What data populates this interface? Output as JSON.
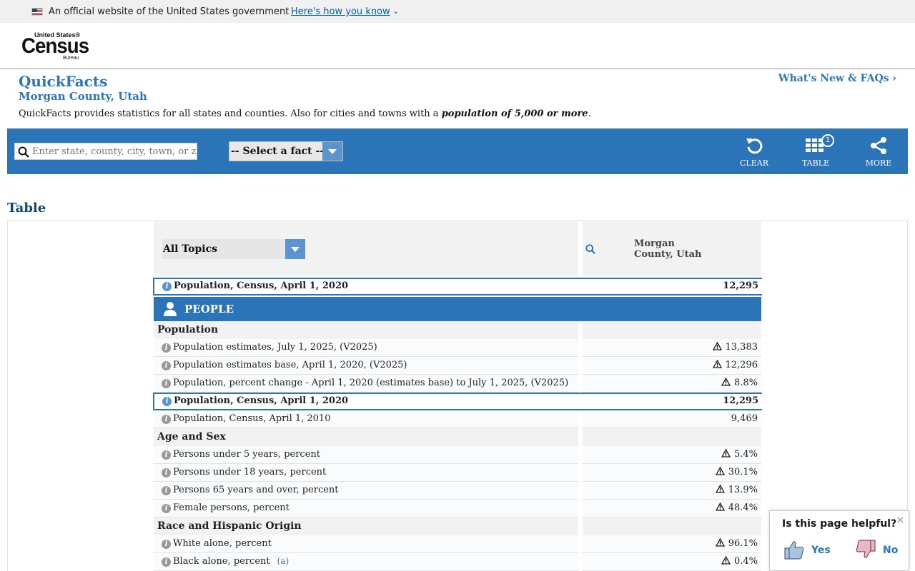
{
  "gov_banner": {
    "text": "An official website of the United States government",
    "link": "Here's how you know",
    "chevron": "⌄"
  },
  "logo": {
    "line1": "United States®",
    "line2": "Census",
    "line3": "Bureau"
  },
  "page": {
    "title": "QuickFacts",
    "subtitle": "Morgan County, Utah",
    "desc_pre": "QuickFacts provides statistics for all states and counties. Also for cities and towns with a ",
    "desc_bold": "population of 5,000 or more",
    "desc_post": ".",
    "whats_new": "What's New & FAQs ›"
  },
  "toolbar": {
    "search_placeholder": "Enter state, county, city, town, or zip code",
    "select_fact": "-- Select a fact --",
    "clear": "CLEAR",
    "table": "TABLE",
    "table_badge": "1",
    "more": "MORE"
  },
  "table": {
    "heading": "Table",
    "topics": "All Topics",
    "column": "Morgan\nCounty, Utah",
    "top_row": {
      "label": "Population, Census, April 1, 2020",
      "value": "12,295"
    },
    "people_label": "PEOPLE",
    "rows": [
      {
        "type": "section",
        "label": "Population"
      },
      {
        "type": "row",
        "label": "Population estimates, July 1, 2025, (V2025)",
        "value": "13,383",
        "warn": true
      },
      {
        "type": "row",
        "label": "Population estimates base, April 1, 2020, (V2025)",
        "value": "12,296",
        "warn": true
      },
      {
        "type": "row",
        "label": "Population, percent change - April 1, 2020 (estimates base) to July 1, 2025, (V2025)",
        "value": "8.8%",
        "warn": true
      },
      {
        "type": "highlight",
        "label": "Population, Census, April 1, 2020",
        "value": "12,295"
      },
      {
        "type": "row",
        "label": "Population, Census, April 1, 2010",
        "value": "9,469",
        "warn": false
      },
      {
        "type": "section",
        "label": "Age and Sex"
      },
      {
        "type": "row",
        "label": "Persons under 5 years, percent",
        "value": "5.4%",
        "warn": true
      },
      {
        "type": "row",
        "label": "Persons under 18 years, percent",
        "value": "30.1%",
        "warn": true
      },
      {
        "type": "row",
        "label": "Persons 65 years and over, percent",
        "value": "13.9%",
        "warn": true
      },
      {
        "type": "row",
        "label": "Female persons, percent",
        "value": "48.4%",
        "warn": true
      },
      {
        "type": "section",
        "label": "Race and Hispanic Origin"
      },
      {
        "type": "row",
        "label": "White alone, percent",
        "value": "96.1%",
        "warn": true
      },
      {
        "type": "row",
        "label": "Black alone, percent",
        "value": "0.4%",
        "warn": true,
        "footnote": "(a)"
      }
    ]
  },
  "feedback": {
    "question": "Is this page helpful?",
    "yes": "Yes",
    "no": "No",
    "close": "×"
  },
  "colors": {
    "brand_blue": "#2b74b8",
    "link_blue": "#2b77b6",
    "heading_navy": "#0f4a6e"
  }
}
